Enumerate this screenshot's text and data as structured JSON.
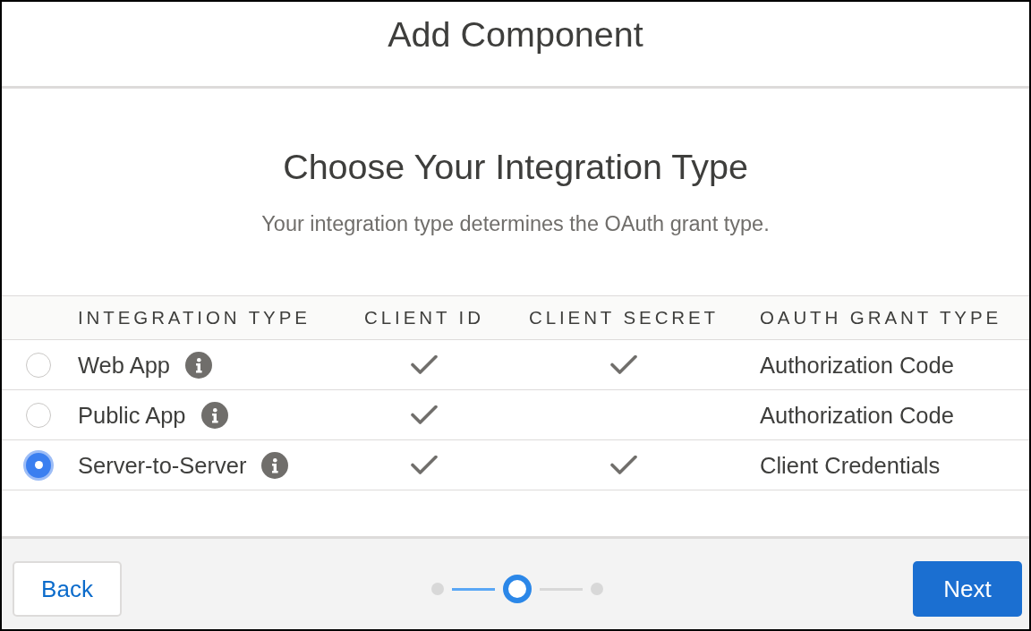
{
  "dialog": {
    "title": "Add Component"
  },
  "intro": {
    "heading": "Choose Your Integration Type",
    "subtitle": "Your integration type determines the OAuth grant type."
  },
  "table": {
    "columns": [
      "INTEGRATION TYPE",
      "CLIENT ID",
      "CLIENT SECRET",
      "OAUTH GRANT TYPE"
    ],
    "rows": [
      {
        "name": "Web App",
        "info": true,
        "client_id": true,
        "client_secret": true,
        "grant_type": "Authorization Code",
        "selected": false
      },
      {
        "name": "Public App",
        "info": true,
        "client_id": true,
        "client_secret": false,
        "grant_type": "Authorization Code",
        "selected": false
      },
      {
        "name": "Server-to-Server",
        "info": true,
        "client_id": true,
        "client_secret": true,
        "grant_type": "Client Credentials",
        "selected": true
      }
    ]
  },
  "footer": {
    "back": "Back",
    "next": "Next",
    "steps": [
      {
        "selected": false
      },
      {
        "selected": true
      },
      {
        "selected": false
      }
    ]
  }
}
